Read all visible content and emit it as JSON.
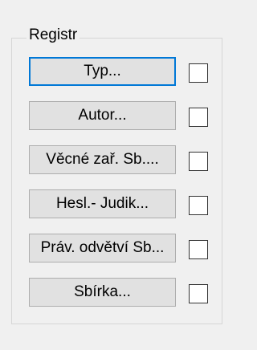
{
  "group": {
    "label": "Registr"
  },
  "buttons": [
    {
      "label": "Typ...",
      "checked": false
    },
    {
      "label": "Autor...",
      "checked": false
    },
    {
      "label": "Věcné zař. Sb....",
      "checked": false
    },
    {
      "label": "Hesl.- Judik...",
      "checked": false
    },
    {
      "label": "Práv. odvětví Sb...",
      "checked": false
    },
    {
      "label": "Sbírka...",
      "checked": false
    }
  ],
  "colors": {
    "default_button_border": "#0078d7",
    "button_face": "#e1e1e1",
    "window_background": "#f0f0f0"
  }
}
